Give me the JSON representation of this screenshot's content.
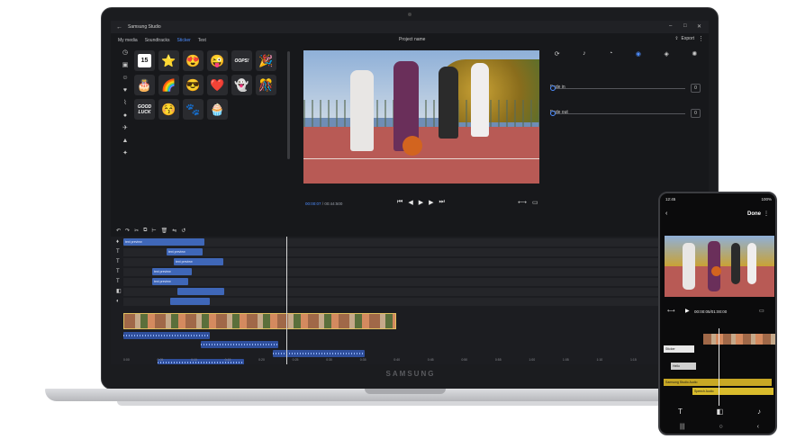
{
  "app": {
    "title": "Samsung Studio",
    "project_name": "Project name",
    "export_label": "Export",
    "tabs": [
      {
        "label": "My media"
      },
      {
        "label": "Soundtracks"
      },
      {
        "label": "Sticker"
      },
      {
        "label": "Text"
      }
    ],
    "active_tab": "Sticker"
  },
  "stickers": [
    {
      "kind": "badge",
      "text": "15"
    },
    {
      "kind": "emoji",
      "glyph": "⭐"
    },
    {
      "kind": "emoji",
      "glyph": "😍"
    },
    {
      "kind": "emoji",
      "glyph": "😜"
    },
    {
      "kind": "text",
      "text": "OOPS!"
    },
    {
      "kind": "emoji",
      "glyph": "🎉"
    },
    {
      "kind": "emoji",
      "glyph": "🎂"
    },
    {
      "kind": "emoji",
      "glyph": "🌈"
    },
    {
      "kind": "emoji",
      "glyph": "😎"
    },
    {
      "kind": "emoji",
      "glyph": "❤️"
    },
    {
      "kind": "emoji",
      "glyph": "👻"
    },
    {
      "kind": "emoji",
      "glyph": "🎊"
    },
    {
      "kind": "text",
      "text": "GOOD LUCK"
    },
    {
      "kind": "emoji",
      "glyph": "😚"
    },
    {
      "kind": "emoji",
      "glyph": "🐾"
    },
    {
      "kind": "emoji",
      "glyph": "🧁"
    }
  ],
  "sticker_categories": [
    "clock-icon",
    "badge-icon",
    "smile-icon",
    "heart-icon",
    "bone-icon",
    "ball-icon",
    "plane-icon",
    "party-icon",
    "sparkle-icon"
  ],
  "player": {
    "current_time": "00:00:07",
    "total_time": "00:44:500"
  },
  "audio_panel": {
    "icons": [
      "rotate-icon",
      "volume-icon",
      "speed-icon",
      "audio-icon",
      "filter-icon",
      "effects-icon"
    ],
    "fade_in": {
      "label": "Fade in",
      "value": "0"
    },
    "fade_out": {
      "label": "Fade out",
      "value": "0"
    }
  },
  "timeline": {
    "track_icons": [
      "sticker-icon",
      "text-icon",
      "text-icon",
      "text-icon",
      "text-icon",
      "sticker-icon",
      "sticker-icon"
    ],
    "clip_label": "text preview",
    "ruler": [
      "0:00",
      "0:05",
      "0:10",
      "0:15",
      "0:20",
      "0:25",
      "0:30",
      "0:35",
      "0:40",
      "0:45",
      "0:50",
      "0:55",
      "1:00",
      "1:05",
      "1:10",
      "1:15"
    ]
  },
  "phone": {
    "time": "12:45",
    "battery": "100%",
    "done_label": "Done",
    "timecode": "00:00:05/01:00:00",
    "lanes": [
      {
        "label": "Sticker"
      },
      {
        "label": "Hello"
      },
      {
        "label": "Samsung Studio Audio"
      },
      {
        "label": "Speech Audio"
      }
    ]
  },
  "brand": "SAMSUNG"
}
